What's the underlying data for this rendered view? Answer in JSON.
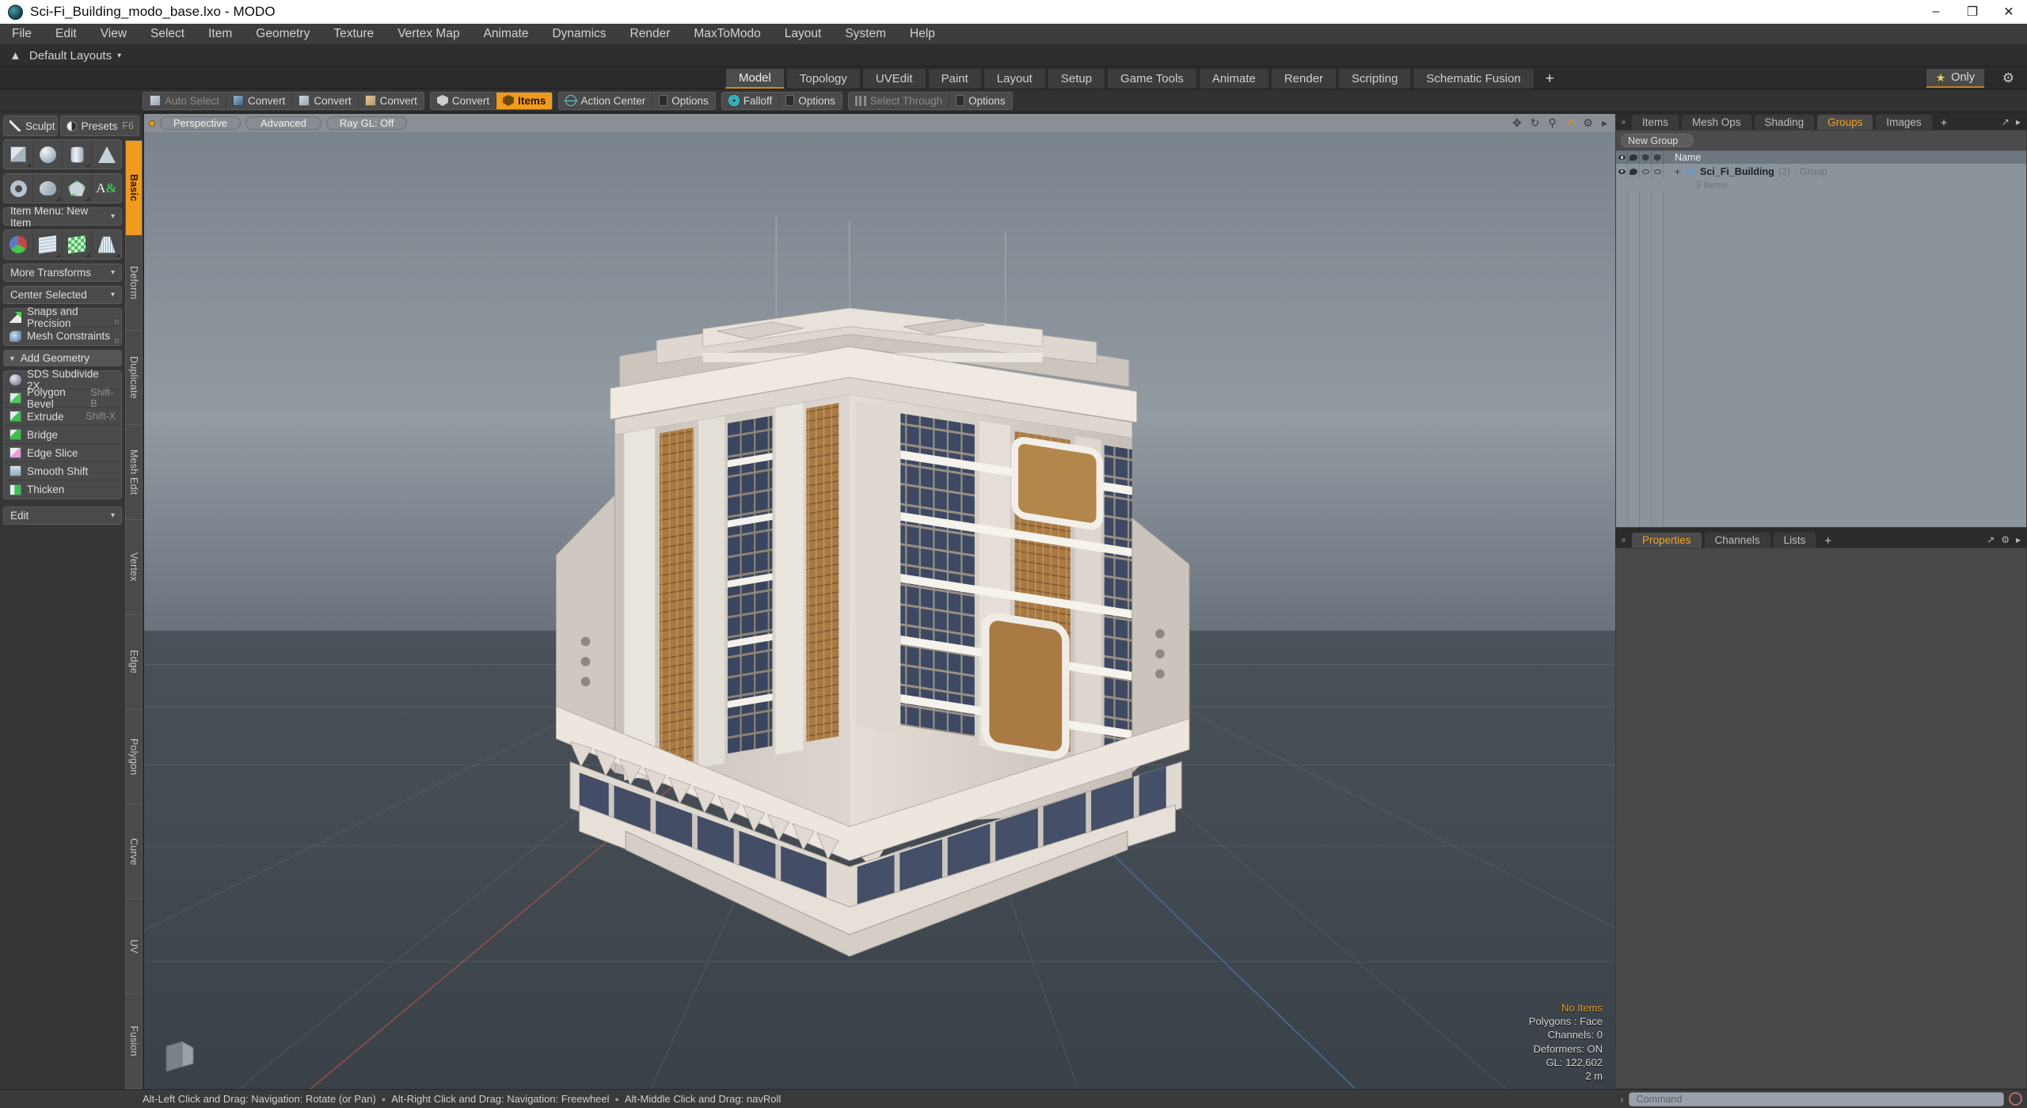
{
  "window": {
    "title": "Sci-Fi_Building_modo_base.lxo - MODO",
    "app_icon": "modo-app-icon",
    "minimize": "–",
    "maximize": "❐",
    "close": "✕"
  },
  "menubar": {
    "items": [
      "File",
      "Edit",
      "View",
      "Select",
      "Item",
      "Geometry",
      "Texture",
      "Vertex Map",
      "Animate",
      "Dynamics",
      "Render",
      "MaxToModo",
      "Layout",
      "System",
      "Help"
    ]
  },
  "layoutbar": {
    "label": "Default Layouts",
    "caret": "▾",
    "up_icon": "collapse-up-icon"
  },
  "layout_tabs": {
    "items": [
      "Model",
      "Topology",
      "UVEdit",
      "Paint",
      "Layout",
      "Setup",
      "Game Tools",
      "Animate",
      "Render",
      "Scripting",
      "Schematic Fusion"
    ],
    "active": "Model",
    "add_label": "+",
    "only_label": "Only",
    "star": "★",
    "gear": "⚙"
  },
  "toolstrip": {
    "groups": [
      {
        "items": [
          {
            "label": "Auto Select",
            "icon": "cube-icon",
            "state": "disabled"
          },
          {
            "label": "Convert",
            "icon": "cube-blue-icon",
            "state": "normal"
          },
          {
            "label": "Convert",
            "icon": "cube-grey-icon",
            "state": "normal"
          },
          {
            "label": "Convert",
            "icon": "cube-tan-icon",
            "state": "normal"
          }
        ]
      },
      {
        "items": [
          {
            "label": "Convert",
            "icon": "shield-icon",
            "state": "normal"
          },
          {
            "label": "Items",
            "icon": "shield-amber-icon",
            "state": "active"
          }
        ]
      },
      {
        "items": [
          {
            "label": "Action Center",
            "icon": "axis-icon",
            "state": "normal"
          },
          {
            "label": "Options",
            "icon": "options-icon",
            "state": "normal"
          }
        ]
      },
      {
        "items": [
          {
            "label": "Falloff",
            "icon": "falloff-icon",
            "state": "normal"
          },
          {
            "label": "Options",
            "icon": "options-icon",
            "state": "normal"
          }
        ]
      },
      {
        "items": [
          {
            "label": "Select Through",
            "icon": "through-icon",
            "state": "disabled"
          },
          {
            "label": "Options",
            "icon": "options-icon",
            "state": "normal"
          }
        ]
      }
    ]
  },
  "left_panel": {
    "sculpt": {
      "label": "Sculpt",
      "icon": "pen-icon"
    },
    "presets": {
      "label": "Presets",
      "shortcut": "F6",
      "icon": "sphere-half-icon"
    },
    "vertical_tabs": {
      "items": [
        "Basic",
        "Deform",
        "Duplicate",
        "Mesh Edit",
        "Vertex",
        "Edge",
        "Polygon",
        "Curve",
        "UV",
        "Fusion"
      ],
      "active": "Basic"
    },
    "primitives_row1": [
      "cube-primitive",
      "sphere-primitive",
      "cylinder-primitive",
      "cone-primitive"
    ],
    "primitives_row2": [
      "torus-primitive",
      "tube-primitive",
      "polygon-primitive",
      "text-primitive"
    ],
    "item_menu": {
      "label": "Item Menu: New Item",
      "caret": "▾"
    },
    "transform_row": [
      "transform-gizmo",
      "bend-tool",
      "quad-tool",
      "taper-tool"
    ],
    "more_transforms": {
      "label": "More Transforms",
      "caret": "▾"
    },
    "center_selected": {
      "label": "Center Selected",
      "caret": "▾"
    },
    "snaps": {
      "label": "Snaps and Precision",
      "icon": "snap-icon"
    },
    "mesh_constraints": {
      "label": "Mesh Constraints",
      "icon": "mesh-constraint-icon"
    },
    "add_geometry": {
      "label": "Add Geometry",
      "triangle": "▼"
    },
    "geometry_actions": [
      {
        "label": "SDS Subdivide 2X",
        "shortcut": "",
        "icon": "sds-icon"
      },
      {
        "label": "Polygon Bevel",
        "shortcut": "Shift-B",
        "icon": "bevel-icon"
      },
      {
        "label": "Extrude",
        "shortcut": "Shift-X",
        "icon": "extrude-icon"
      },
      {
        "label": "Bridge",
        "shortcut": "",
        "icon": "bridge-icon"
      },
      {
        "label": "Edge Slice",
        "shortcut": "",
        "icon": "slice-icon"
      },
      {
        "label": "Smooth Shift",
        "shortcut": "",
        "icon": "smooth-shift-icon"
      },
      {
        "label": "Thicken",
        "shortcut": "",
        "icon": "thicken-icon"
      }
    ],
    "edit_dropdown": {
      "label": "Edit",
      "caret": "▾"
    }
  },
  "viewport": {
    "header": {
      "pills": [
        "Perspective",
        "Advanced",
        "Ray GL: Off"
      ],
      "icons": [
        "pan-icon",
        "rotate-icon",
        "zoom-icon",
        "fit-icon",
        "gear-icon",
        "arrow-right-icon"
      ]
    },
    "stats": {
      "selection": "No Items",
      "polygons": "Polygons : Face",
      "channels": "Channels: 0",
      "deformers": "Deformers: ON",
      "gl": "GL: 122,602",
      "scale": "2 m"
    },
    "model": {
      "name": "Sci-Fi Building",
      "facade_color": "#d9d4cd",
      "window_color": "#3a4560",
      "accent_color": "#a97a43",
      "trim_color": "#ffffff"
    }
  },
  "right_panel": {
    "top_tabs": {
      "items": [
        "Items",
        "Mesh Ops",
        "Shading",
        "Groups",
        "Images"
      ],
      "active": "Groups",
      "add_label": "+"
    },
    "new_group_button": "New Group",
    "columns": [
      "visibility-column",
      "material-column",
      "render-column",
      "lock-column",
      "Name"
    ],
    "name_header": "Name",
    "rows": [
      {
        "expander": "+",
        "icon": "group-icon",
        "name": "Sci_Fi_Building",
        "count": "(2)",
        "type": ": Group",
        "sub": "3 Items"
      }
    ],
    "bottom_tabs": {
      "items": [
        "Properties",
        "Channels",
        "Lists"
      ],
      "active": "Properties",
      "add_label": "+"
    }
  },
  "statusbar": {
    "hints": [
      "Alt-Left Click and Drag: Navigation: Rotate (or Pan)",
      "Alt-Right Click and Drag: Navigation: Freewheel",
      "Alt-Middle Click and Drag: navRoll"
    ],
    "separator": "●",
    "command": {
      "arrow": "›",
      "placeholder": "Command"
    }
  },
  "colors": {
    "accent_orange": "#f09a1e",
    "panel_bg": "#3a3a3a",
    "viewport_top": "#8e969e",
    "viewport_bottom": "#3c4349"
  }
}
